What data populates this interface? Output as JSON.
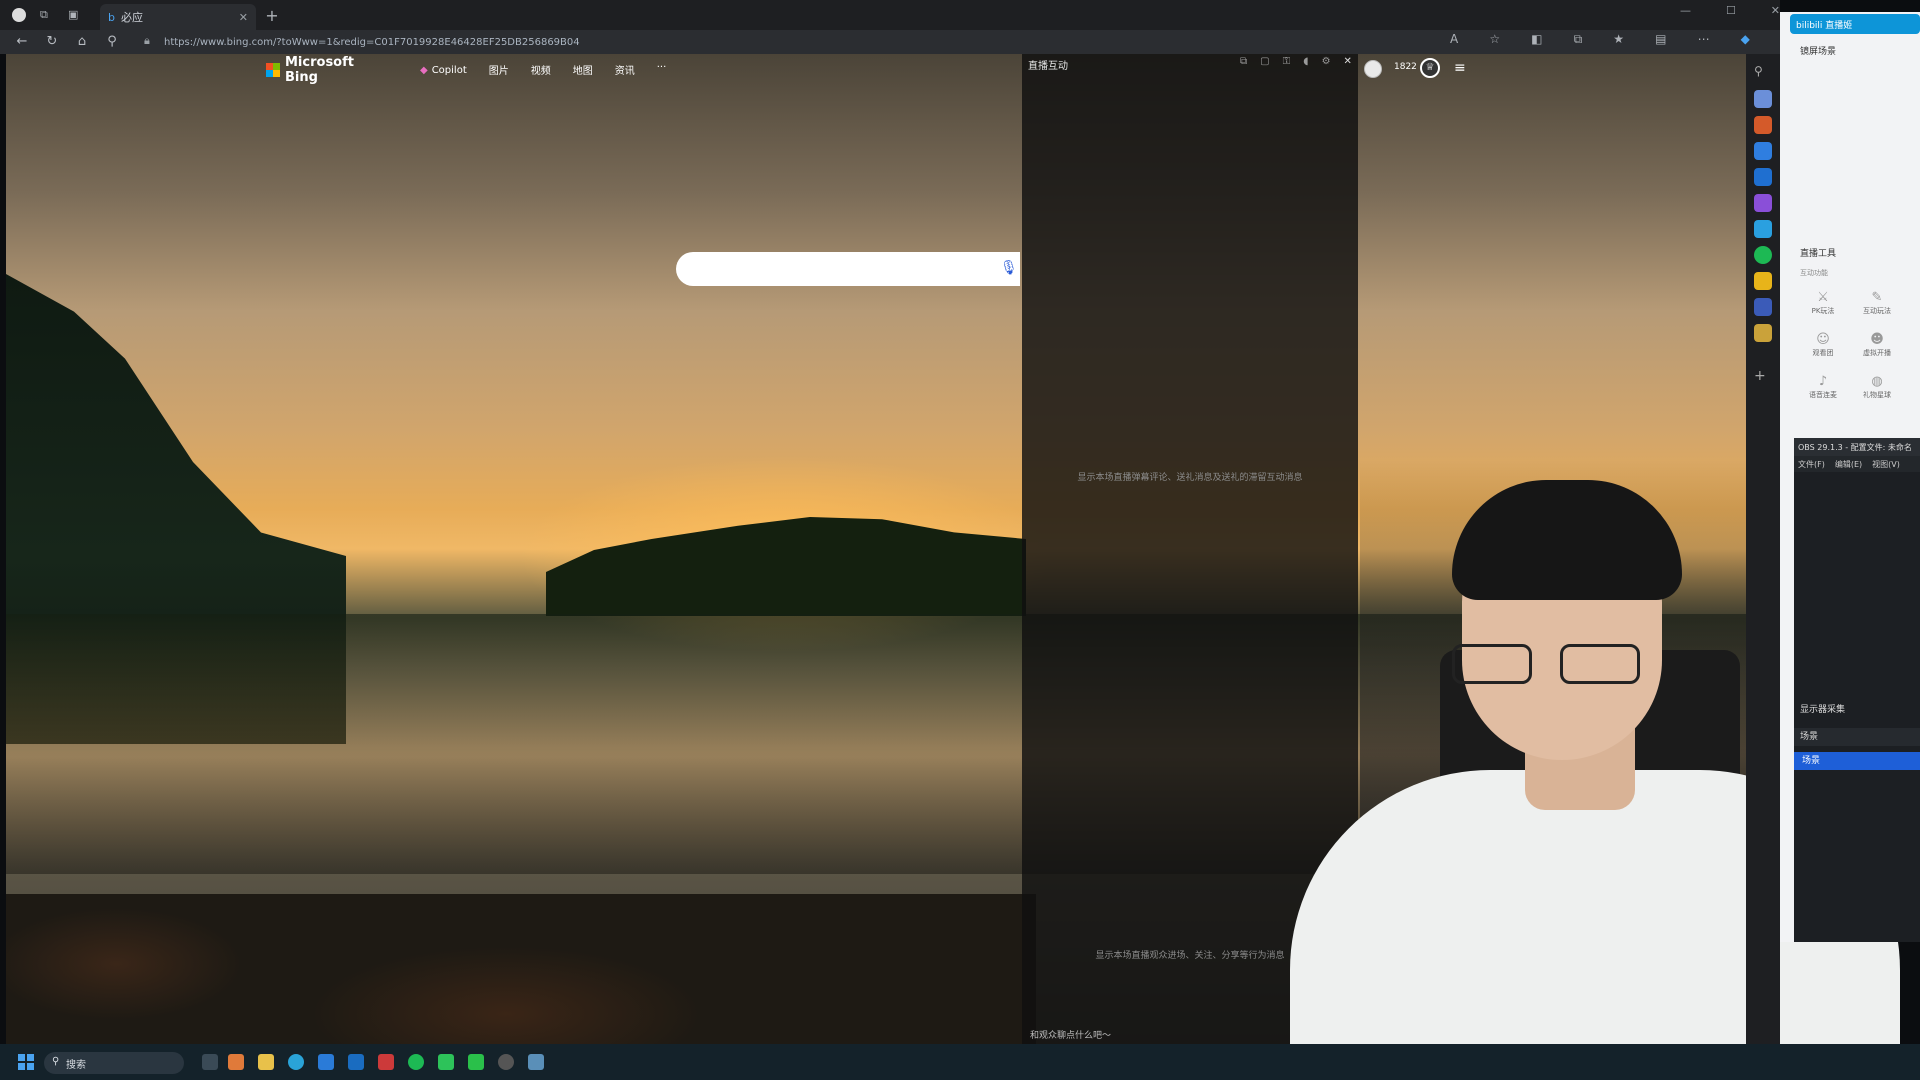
{
  "browser": {
    "tab_title": "必应",
    "url": "https://www.bing.com/?toWww=1&redig=C01F7019928E46428EF25DB256869B04"
  },
  "bing": {
    "logo_text": "Microsoft Bing",
    "nav": [
      "Copilot",
      "图片",
      "视频",
      "地图",
      "资讯",
      "···"
    ],
    "search_placeholder": "",
    "points": "1822"
  },
  "live_panel": {
    "title": "直播互动",
    "message_top": "显示本场直播弹幕评论、送礼消息及送礼的滞留互动消息",
    "message_bottom": "显示本场直播观众进场、关注、分享等行为消息",
    "input_hint": "和观众聊点什么吧～"
  },
  "right_panel": {
    "header": "bilibili 直播姬",
    "scene_title": "镜屏场景",
    "tools_title": "直播工具",
    "tools_sub": "互动功能",
    "tools": [
      "PK玩法",
      "互动玩法",
      "观看团",
      "虚拟开播",
      "语音连麦",
      "礼物星球",
      "",
      ""
    ],
    "obs_title": "OBS 29.1.3 - 配置文件: 未命名",
    "obs_menu": [
      "文件(F)",
      "编辑(E)",
      "视图(V)"
    ],
    "obs_display": "显示器采集",
    "obs_scenes_label": "场景",
    "obs_scene_item": "场景"
  },
  "taskbar": {
    "search_label": "搜索"
  },
  "colors": {
    "bing_blue": "#2a5bd7",
    "obs_selected": "#1e5fd8",
    "bili_blue": "#0d95d8"
  }
}
